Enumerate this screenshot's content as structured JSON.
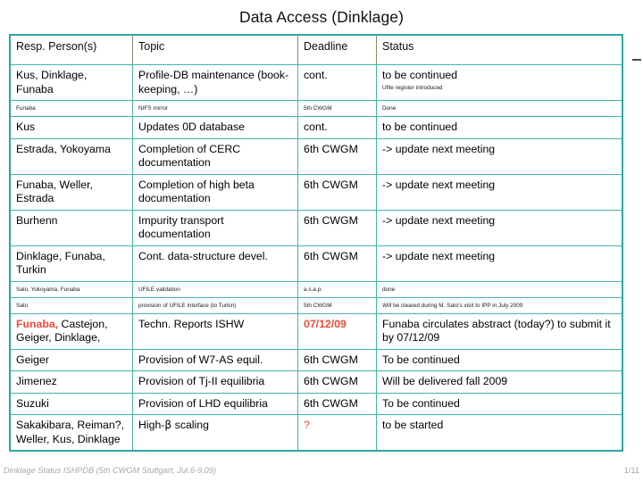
{
  "slide": {
    "title": "Data Access (Dinklage)",
    "accent_header_color": "#fb9467",
    "border_color": "#46b3a9",
    "highlight_color": "#ec4b3a"
  },
  "table": {
    "columns": [
      "Resp. Person(s)",
      "Topic",
      "Deadline",
      "Status"
    ],
    "rows": [
      {
        "size": "normal",
        "person": "Kus, Dinklage, Funaba",
        "topic": "Profile-DB maintenance (book-keeping, …)",
        "deadline": "cont.",
        "status": "to be continued",
        "status_note": "Ufile register introduced"
      },
      {
        "size": "small",
        "person": "Funaba",
        "topic": "NIFS mirror",
        "deadline": "5th CWGM",
        "status": "Done"
      },
      {
        "size": "normal",
        "person": "Kus",
        "topic": "Updates 0D database",
        "deadline": "cont.",
        "status": "to be continued"
      },
      {
        "size": "normal",
        "person": "Estrada, Yokoyama",
        "topic": "Completion of CERC documentation",
        "deadline": "6th CWGM",
        "status": "-> update next meeting"
      },
      {
        "size": "normal",
        "person": "Funaba, Weller, Estrada",
        "topic": "Completion of high beta documentation",
        "deadline": "6th CWGM",
        "status": "-> update next meeting"
      },
      {
        "size": "normal",
        "person": "Burhenn",
        "topic": "Impurity transport documentation",
        "deadline": "6th CWGM",
        "status": "-> update next meeting"
      },
      {
        "size": "person-small",
        "person": "Dinklage, Funaba, Turkin",
        "topic": "Cont. data-structure devel.",
        "deadline": "6th CWGM",
        "status": "-> update next meeting"
      },
      {
        "size": "small",
        "person": "Sato, Yokoyama, Funaba",
        "topic": "UFILE validation",
        "deadline": "a.s.a.p.",
        "status": "done"
      },
      {
        "size": "small",
        "person": "Sato",
        "topic": "provision of UFILE interface (to Turkin)",
        "deadline": "5th CWGM",
        "status": "Will be cleared during M. Sato's visit to IPP in July 2009"
      },
      {
        "size": "normal",
        "person_highlight": "Funaba,",
        "person": " Castejon, Geiger, Dinklage,",
        "topic": "Techn. Reports ISHW",
        "deadline": "07/12/09",
        "deadline_highlight": true,
        "status": "Funaba circulates abstract (today?) to submit it by 07/12/09"
      },
      {
        "size": "normal",
        "person": "Geiger",
        "topic": "Provision of W7-AS equil.",
        "deadline": "6th CWGM",
        "status": "To be continued"
      },
      {
        "size": "normal",
        "person": "Jimenez",
        "topic": "Provision of Tj-II equilibria",
        "deadline": "6th CWGM",
        "status": "Will be delivered fall 2009"
      },
      {
        "size": "normal",
        "person": "Suzuki",
        "topic": "Provision of LHD equilibria",
        "deadline": "6th CWGM",
        "status": "To be continued"
      },
      {
        "size": "person-small",
        "person": "Sakakibara, Reiman?, Weller, Kus, Dinklage",
        "topic": "High-β scaling",
        "deadline": "?",
        "deadline_highlight": true,
        "status": "to be started"
      }
    ]
  },
  "footer": {
    "left": "Dinklage Status ISHPDB (5th CWGM Stuttgart, Jul.6-9,09)",
    "right": "1/11"
  }
}
